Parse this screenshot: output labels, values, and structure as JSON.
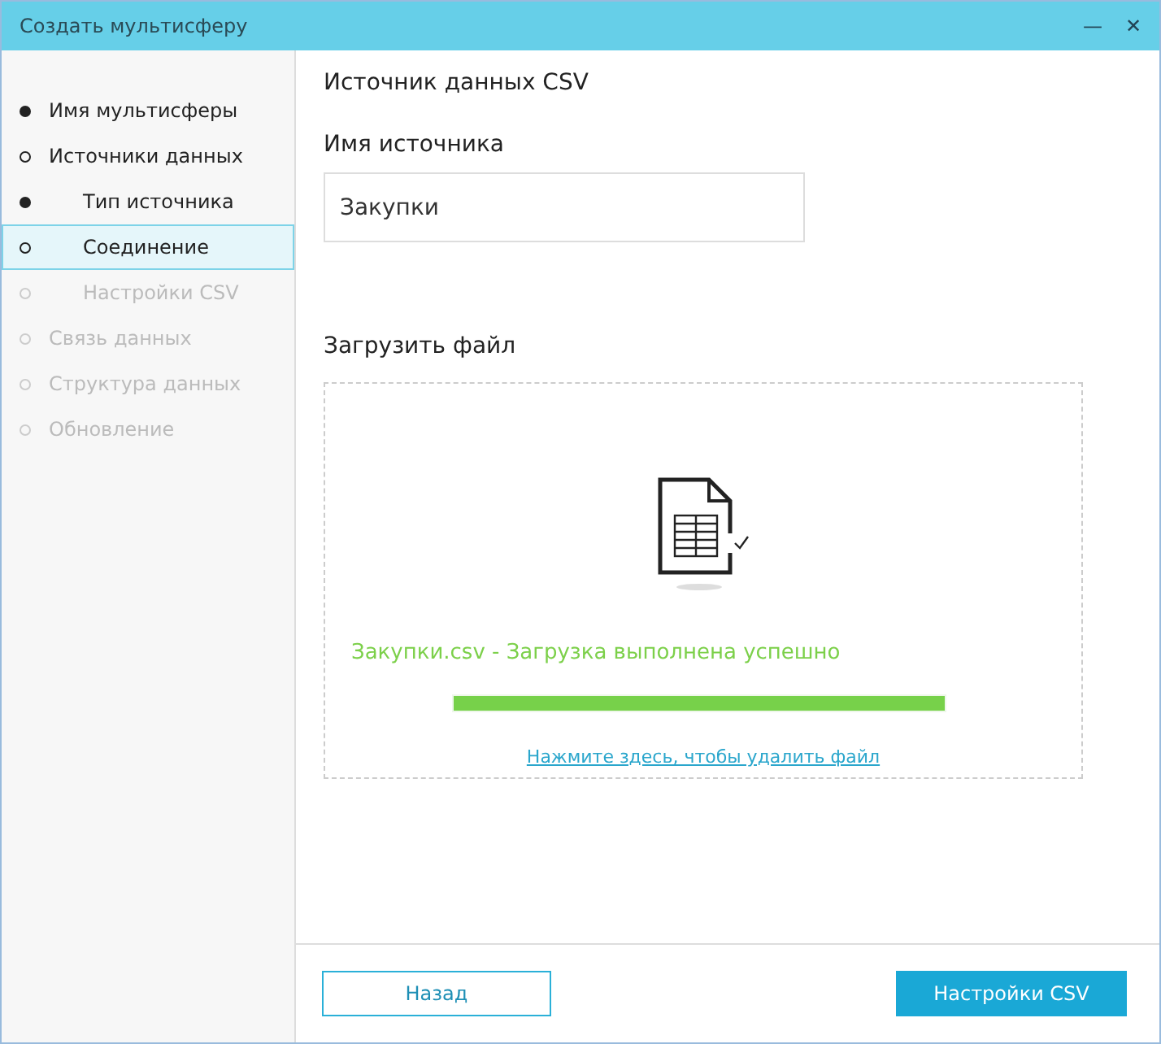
{
  "window": {
    "title": "Создать мультисферу",
    "controls": [
      "—",
      "✕"
    ]
  },
  "steps": [
    {
      "label": "Имя мультисферы",
      "kind": "done",
      "selected": false
    },
    {
      "label": "Источники данных",
      "kind": "current",
      "selected": false,
      "children": [
        {
          "label": "Тип источника",
          "kind": "done",
          "selected": false
        },
        {
          "label": "Соединение",
          "kind": "current",
          "selected": true
        },
        {
          "label": "Настройки CSV",
          "kind": "pending",
          "selected": false
        }
      ]
    },
    {
      "label": "Связь данных",
      "kind": "pending",
      "selected": false
    },
    {
      "label": "Структура данных",
      "kind": "pending",
      "selected": false
    },
    {
      "label": "Обновление",
      "kind": "pending",
      "selected": false
    }
  ],
  "heading": "Источник данных CSV",
  "source_name": {
    "label": "Имя источника",
    "value": "Закупки"
  },
  "upload": {
    "label": "Загрузить файл",
    "status": "Закупки.csv - Загрузка выполнена успешно",
    "level": 1,
    "remove_link": "Нажмите здесь, чтобы удалить файл"
  },
  "buttons": {
    "back": "Назад",
    "next": "Настройки CSV"
  }
}
